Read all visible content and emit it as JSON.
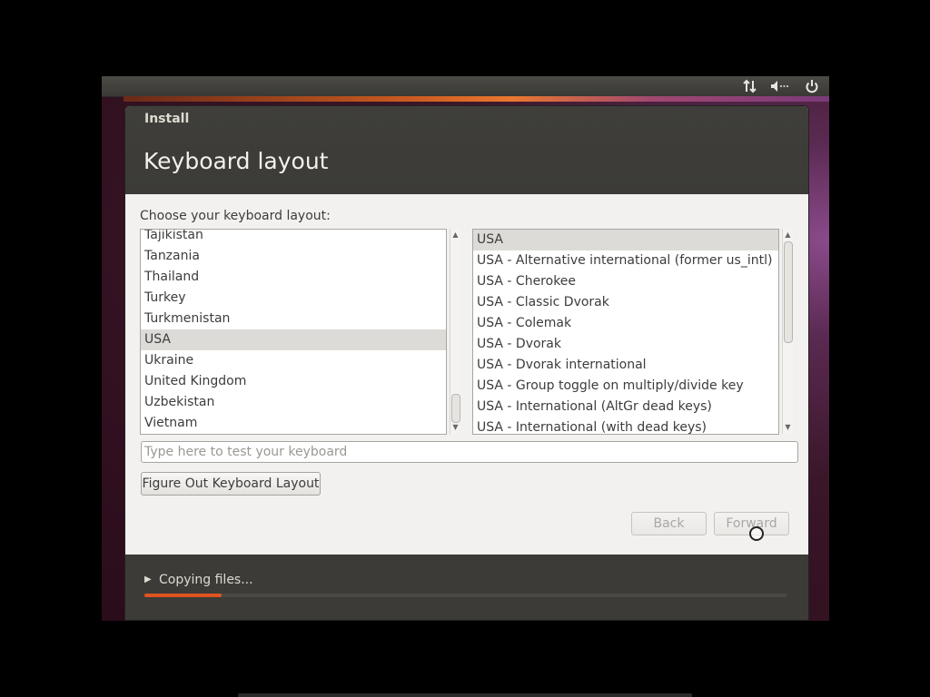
{
  "window": {
    "title": "Install"
  },
  "page": {
    "title": "Keyboard layout",
    "choose_label": "Choose your keyboard layout:"
  },
  "layouts": {
    "items": [
      "Tajikistan",
      "Tanzania",
      "Thailand",
      "Turkey",
      "Turkmenistan",
      "USA",
      "Ukraine",
      "United Kingdom",
      "Uzbekistan",
      "Vietnam"
    ],
    "selected": "USA"
  },
  "variants": {
    "items": [
      "USA",
      "USA - Alternative international (former us_intl)",
      "USA - Cherokee",
      "USA - Classic Dvorak",
      "USA - Colemak",
      "USA - Dvorak",
      "USA - Dvorak international",
      "USA - Group toggle on multiply/divide key",
      "USA - International (AltGr dead keys)",
      "USA - International (with dead keys)"
    ],
    "selected": "USA"
  },
  "test_input": {
    "placeholder": "Type here to test your keyboard",
    "value": ""
  },
  "buttons": {
    "figure_out": "Figure Out Keyboard Layout",
    "back": "Back",
    "forward": "Forward"
  },
  "footer": {
    "status": "Copying files...",
    "progress_percent": 12
  },
  "top_panel": {
    "icons": [
      "network-icon",
      "volume-icon",
      "power-icon"
    ]
  },
  "colors": {
    "accent": "#e05420",
    "header": "#3c3b37"
  }
}
